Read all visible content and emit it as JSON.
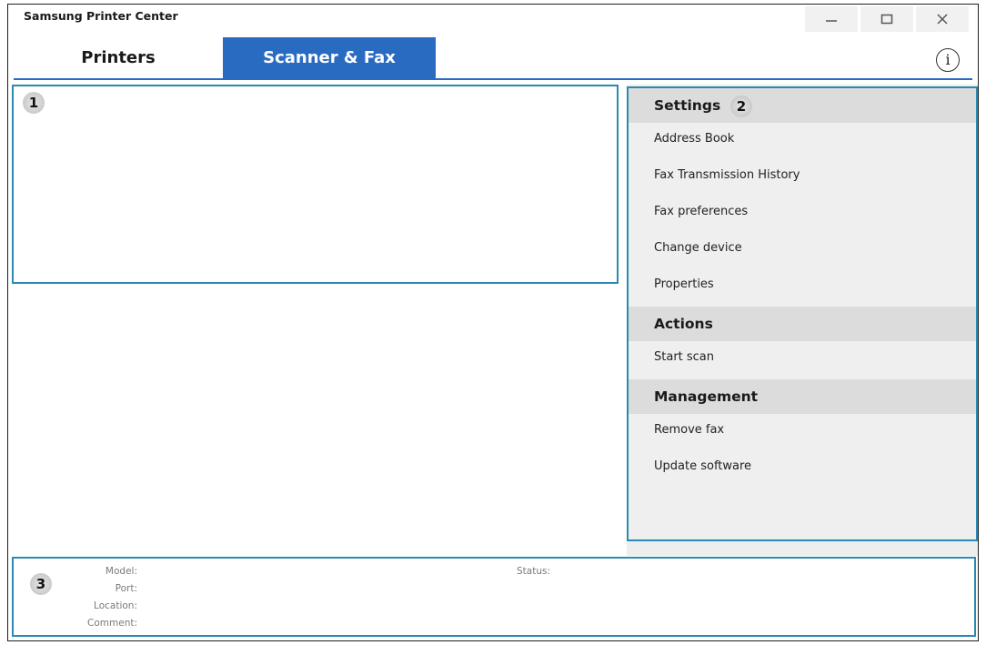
{
  "window": {
    "title": "Samsung Printer Center",
    "controls": [
      {
        "name": "minimize-icon",
        "glyph": "minimize"
      },
      {
        "name": "maximize-icon",
        "glyph": "maximize"
      },
      {
        "name": "close-icon",
        "glyph": "close"
      }
    ]
  },
  "tabs": [
    {
      "label": "Printers",
      "active": false
    },
    {
      "label": "Scanner & Fax",
      "active": true
    }
  ],
  "info_button": {
    "icon": "info-icon",
    "glyph": "i"
  },
  "callouts": [
    "1",
    "2",
    "3"
  ],
  "sidebar": {
    "sections": [
      {
        "title": "Settings",
        "items": [
          "Address Book",
          "Fax Transmission History",
          "Fax preferences",
          "Change device",
          "Properties"
        ]
      },
      {
        "title": "Actions",
        "items": [
          "Start scan"
        ]
      },
      {
        "title": "Management",
        "items": [
          "Remove fax",
          "Update software"
        ]
      }
    ]
  },
  "device_info": {
    "model_label": "Model:",
    "port_label": "Port:",
    "location_label": "Location:",
    "comment_label": "Comment:",
    "status_label": "Status:"
  },
  "colors": {
    "accent": "#2a6bc2",
    "panel_border": "#2a8ab3",
    "section_header_bg": "#dcdcdc",
    "sidebar_bg": "#efefef"
  }
}
